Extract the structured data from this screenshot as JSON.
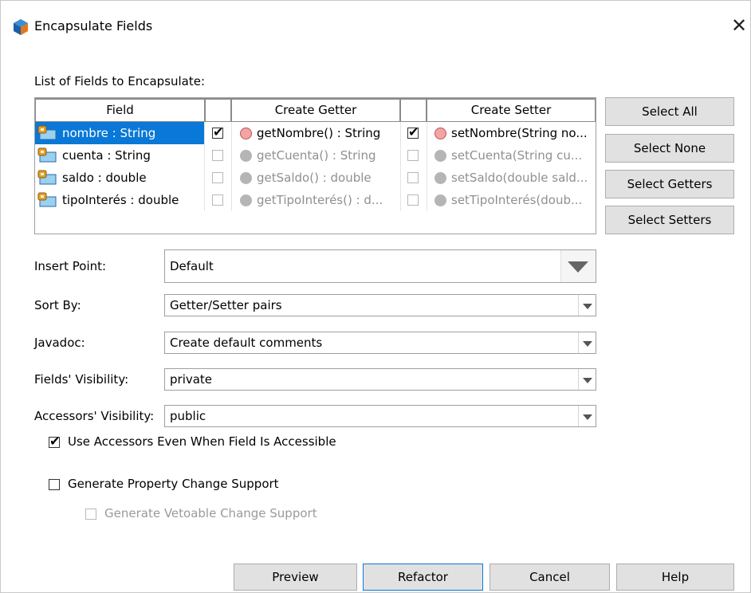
{
  "window": {
    "title": "Encapsulate Fields",
    "close_glyph": "✕",
    "accent_color": "#0a78d7"
  },
  "fields_table": {
    "label": "List of Fields to Encapsulate:",
    "headers": {
      "field": "Field",
      "getter": "Create Getter",
      "setter": "Create Setter"
    },
    "rows": [
      {
        "field": "nombre : String",
        "getter_checked": true,
        "getter": "getNombre() : String",
        "setter_checked": true,
        "setter": "setNombre(String no...",
        "selected": true
      },
      {
        "field": "cuenta : String",
        "getter_checked": false,
        "getter": "getCuenta() : String",
        "setter_checked": false,
        "setter": "setCuenta(String cu...",
        "selected": false
      },
      {
        "field": "saldo : double",
        "getter_checked": false,
        "getter": "getSaldo() : double",
        "setter_checked": false,
        "setter": "setSaldo(double sald...",
        "selected": false
      },
      {
        "field": "tipoInterés : double",
        "getter_checked": false,
        "getter": "getTipoInterés() : d...",
        "setter_checked": false,
        "setter": "setTipoInterés(doub...",
        "selected": false
      }
    ]
  },
  "side_buttons": {
    "select_all": "Select All",
    "select_none": "Select None",
    "select_getters": "Select Getters",
    "select_setters": "Select Setters"
  },
  "options": {
    "insert_point": {
      "label": "Insert Point:",
      "value": "Default"
    },
    "sort_by": {
      "label": "Sort By:",
      "value": "Getter/Setter pairs"
    },
    "javadoc": {
      "label": "Javadoc:",
      "value": "Create default comments"
    },
    "fields_visibility": {
      "label": "Fields' Visibility:",
      "value": "private"
    },
    "accessors_visibility": {
      "label": "Accessors' Visibility:",
      "value": "public"
    }
  },
  "checkboxes": {
    "use_accessors": {
      "label": "Use Accessors Even When Field Is Accessible",
      "checked": true
    },
    "property_change": {
      "label": "Generate Property Change Support",
      "checked": false
    },
    "vetoable_change": {
      "label": "Generate Vetoable Change Support",
      "checked": false,
      "enabled": false
    }
  },
  "bottom_buttons": {
    "preview": "Preview",
    "refactor": "Refactor",
    "cancel": "Cancel",
    "help": "Help"
  },
  "check_glyph": "✔"
}
